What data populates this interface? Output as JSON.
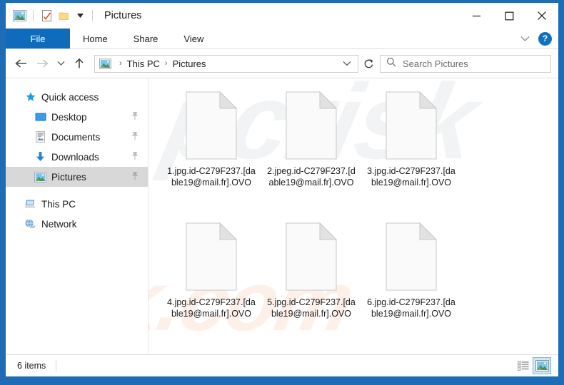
{
  "window": {
    "title": "Pictures",
    "quick_access_toolbar": [
      {
        "name": "pictures-icon",
        "label": "Pictures"
      },
      {
        "name": "properties-icon",
        "label": "Properties"
      },
      {
        "name": "new-folder-icon",
        "label": "New folder"
      },
      {
        "name": "chevron-down-icon",
        "label": "Customize Quick Access Toolbar"
      }
    ],
    "controls": [
      {
        "name": "minimize-button",
        "label": "Minimize"
      },
      {
        "name": "maximize-button",
        "label": "Maximize"
      },
      {
        "name": "close-button",
        "label": "Close"
      }
    ]
  },
  "ribbon": {
    "tabs": [
      {
        "label": "File",
        "active": true
      },
      {
        "label": "Home",
        "active": false
      },
      {
        "label": "Share",
        "active": false
      },
      {
        "label": "View",
        "active": false
      }
    ],
    "expand_label": "Expand the Ribbon",
    "help_label": "?"
  },
  "navigation": {
    "back_label": "Back",
    "forward_label": "Forward",
    "recent_label": "Recent locations",
    "up_label": "Up",
    "refresh_label": "Refresh",
    "address": {
      "icon": "pictures-icon",
      "crumbs": [
        "This PC",
        "Pictures"
      ],
      "separator": "›",
      "dropdown_label": "Previous locations"
    },
    "search": {
      "placeholder": "Search Pictures",
      "icon": "search-icon",
      "value": ""
    }
  },
  "sidebar": {
    "items": [
      {
        "label": "Quick access",
        "icon": "star-icon",
        "indent": false,
        "pinned": false,
        "selected": false
      },
      {
        "label": "Desktop",
        "icon": "desktop-icon",
        "indent": true,
        "pinned": true,
        "selected": false
      },
      {
        "label": "Documents",
        "icon": "documents-icon",
        "indent": true,
        "pinned": true,
        "selected": false
      },
      {
        "label": "Downloads",
        "icon": "downloads-icon",
        "indent": true,
        "pinned": true,
        "selected": false
      },
      {
        "label": "Pictures",
        "icon": "pictures-icon",
        "indent": true,
        "pinned": true,
        "selected": true
      },
      {
        "label": "This PC",
        "icon": "thispc-icon",
        "indent": false,
        "pinned": false,
        "selected": false
      },
      {
        "label": "Network",
        "icon": "network-icon",
        "indent": false,
        "pinned": false,
        "selected": false
      }
    ]
  },
  "files": [
    {
      "name": "1.jpg.id-C279F237.[dable19@mail.fr].OVO",
      "icon": "blank-document-icon"
    },
    {
      "name": "2.jpeg.id-C279F237.[dable19@mail.fr].OVO",
      "icon": "blank-document-icon"
    },
    {
      "name": "3.jpg.id-C279F237.[dable19@mail.fr].OVO",
      "icon": "blank-document-icon"
    },
    {
      "name": "4.jpg.id-C279F237.[dable19@mail.fr].OVO",
      "icon": "blank-document-icon"
    },
    {
      "name": "5.jpg.id-C279F237.[dable19@mail.fr].OVO",
      "icon": "blank-document-icon"
    },
    {
      "name": "6.jpg.id-C279F237.[dable19@mail.fr].OVO",
      "icon": "blank-document-icon"
    }
  ],
  "watermarks": {
    "top": "pcrisk",
    "bottom": "risk.com"
  },
  "statusbar": {
    "item_count": "6 items",
    "views": [
      {
        "name": "details-view-button",
        "label": "Details",
        "active": false
      },
      {
        "name": "large-icons-view-button",
        "label": "Large icons",
        "active": true
      }
    ]
  },
  "colors": {
    "accent": "#0f6cbd",
    "desktop": "#1d6cb5",
    "selection": "#d8d8d8",
    "view_active": "#cde8f7"
  }
}
